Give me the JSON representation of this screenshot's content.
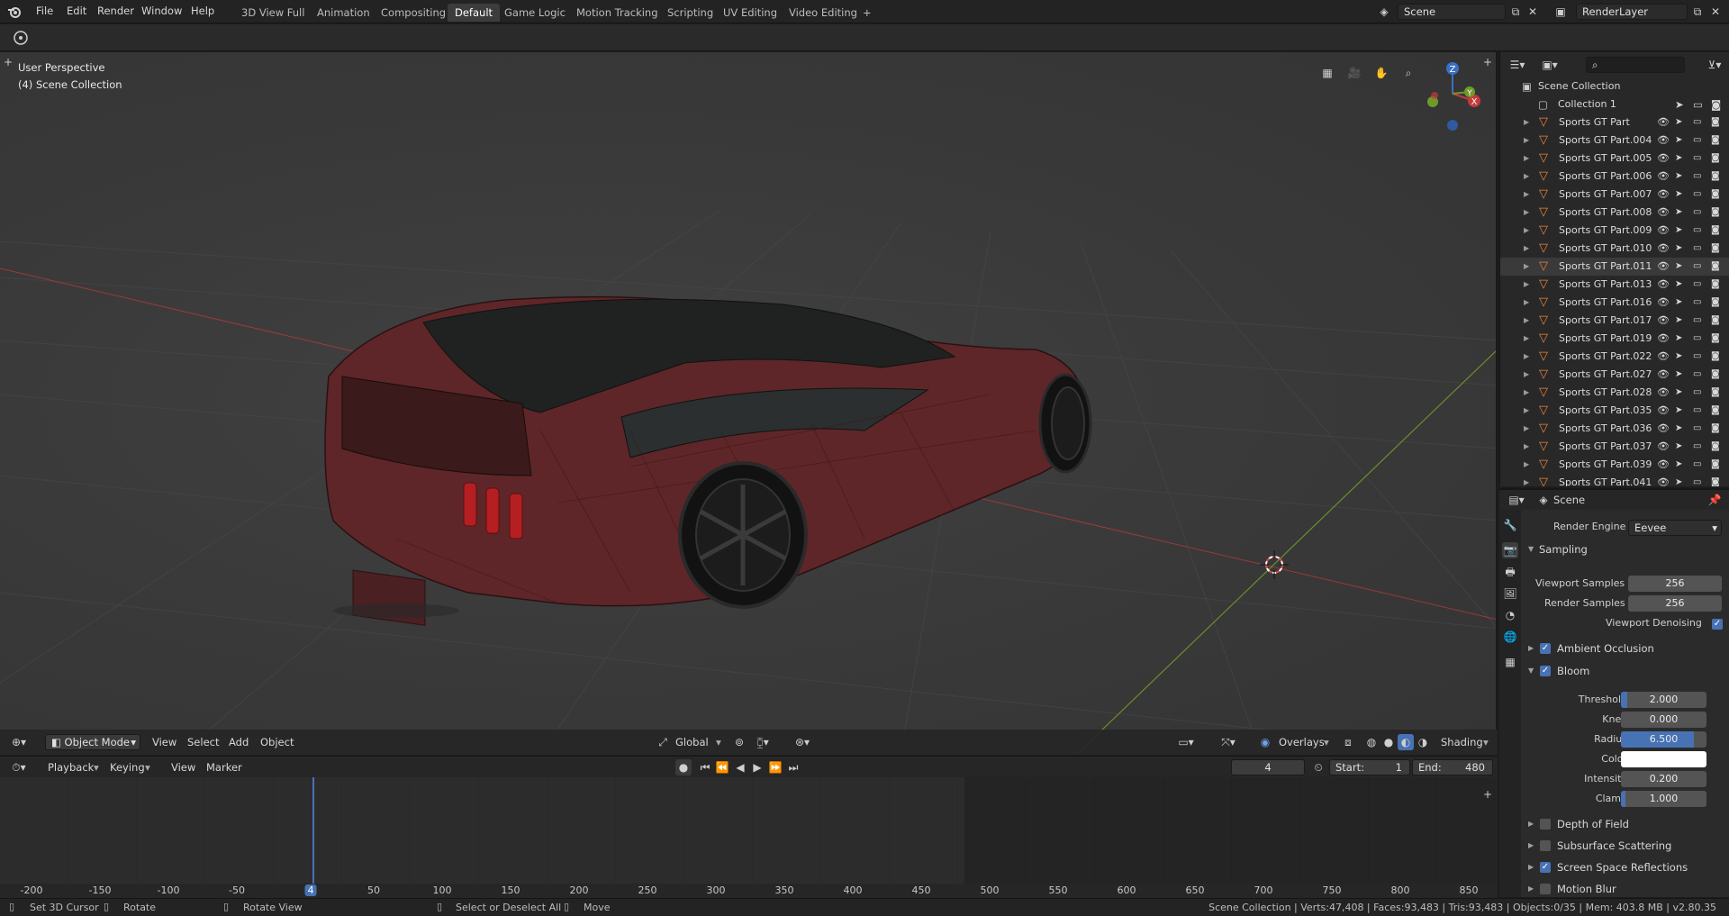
{
  "topbar": {
    "menu": [
      "File",
      "Edit",
      "Render",
      "Window",
      "Help"
    ],
    "workspaces": [
      "3D View Full",
      "Animation",
      "Compositing",
      "Default",
      "Game Logic",
      "Motion Tracking",
      "Scripting",
      "UV Editing",
      "Video Editing"
    ],
    "active_workspace": "Default",
    "add_tab": "+",
    "scene": "Scene",
    "render_layer": "RenderLayer"
  },
  "viewport": {
    "overlay_title": "User Perspective",
    "overlay_collection": "(4) Scene Collection",
    "gizmo": {
      "z": "Z",
      "y": "Y",
      "x": "X"
    }
  },
  "viewport_header": {
    "mode": "Object Mode",
    "menus": [
      "View",
      "Select",
      "Add",
      "Object"
    ],
    "orientation": "Global",
    "overlays": "Overlays",
    "shading": "Shading"
  },
  "timeline": {
    "menus": [
      "Playback",
      "Keying",
      "View",
      "Marker"
    ],
    "current_frame": "4",
    "start_label": "Start:",
    "start": "1",
    "end_label": "End:",
    "end": "480",
    "ruler": [
      "-200",
      "-150",
      "-100",
      "-50",
      "4",
      "50",
      "100",
      "150",
      "200",
      "250",
      "300",
      "350",
      "400",
      "450",
      "500",
      "550",
      "600",
      "650",
      "700",
      "750",
      "800",
      "850"
    ]
  },
  "outliner": {
    "root": "Scene Collection",
    "collection": "Collection 1",
    "items": [
      "Sports GT Part",
      "Sports GT Part.004",
      "Sports GT Part.005",
      "Sports GT Part.006",
      "Sports GT Part.007",
      "Sports GT Part.008",
      "Sports GT Part.009",
      "Sports GT Part.010",
      "Sports GT Part.011",
      "Sports GT Part.013",
      "Sports GT Part.016",
      "Sports GT Part.017",
      "Sports GT Part.019",
      "Sports GT Part.022",
      "Sports GT Part.027",
      "Sports GT Part.028",
      "Sports GT Part.035",
      "Sports GT Part.036",
      "Sports GT Part.037",
      "Sports GT Part.039",
      "Sports GT Part.041"
    ],
    "selected_item": "Sports GT Part.011"
  },
  "properties": {
    "context": "Scene",
    "render_engine_label": "Render Engine",
    "render_engine": "Eevee",
    "sampling": "Sampling",
    "viewport_samples_label": "Viewport Samples",
    "viewport_samples": "256",
    "render_samples_label": "Render Samples",
    "render_samples": "256",
    "viewport_denoising_label": "Viewport Denoising",
    "ambient_occlusion": "Ambient Occlusion",
    "bloom": "Bloom",
    "threshold_label": "Threshold",
    "threshold": "2.000",
    "threshold_fill": 0.07,
    "knee_label": "Knee",
    "knee": "0.000",
    "knee_fill": 0.0,
    "radius_label": "Radius",
    "radius": "6.500",
    "radius_fill": 0.85,
    "color_label": "Color",
    "color_value": "#ffffff",
    "intensity_label": "Intensity",
    "intensity": "0.200",
    "intensity_fill": 0.0,
    "clamp_label": "Clamp",
    "clamp": "1.000",
    "clamp_fill": 0.05,
    "depth_of_field": "Depth of Field",
    "subsurface": "Subsurface Scattering",
    "ssr": "Screen Space Reflections",
    "motion_blur": "Motion Blur"
  },
  "statusbar": {
    "hint1": "Set 3D Cursor",
    "hint2": "Rotate",
    "hint3": "Rotate View",
    "hint4": "Select or Deselect All",
    "hint5": "Move",
    "stats": "Scene Collection | Verts:47,408 | Faces:93,483 | Tris:93,483 | Objects:0/35 | Mem: 403.8 MB | v2.80.35"
  },
  "colors": {
    "accent": "#4772b3",
    "car_body": "#6b2a2c",
    "x_axis": "#c43a3a",
    "y_axis": "#6f9a2a",
    "mesh_icon": "#e8833a"
  }
}
